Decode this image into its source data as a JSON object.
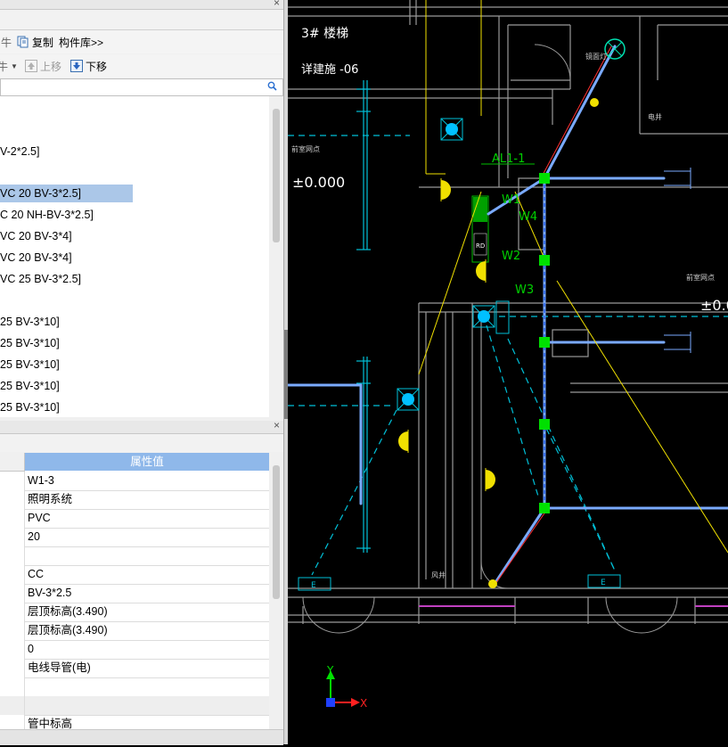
{
  "toolbar1": {
    "partial_label": "",
    "copy_label": "复制",
    "library_label": "构件库>>"
  },
  "toolbar2": {
    "up_label": "上移",
    "down_label": "下移"
  },
  "search": {
    "value": "",
    "placeholder": ""
  },
  "tree": {
    "items": [
      {
        "label": "V-2*2.5]"
      },
      {
        "label": "VC 20 BV-3*2.5]",
        "selected": true
      },
      {
        "label": "C 20 NH-BV-3*2.5]"
      },
      {
        "label": "VC 20 BV-3*4]"
      },
      {
        "label": "VC 20 BV-3*4]"
      },
      {
        "label": "VC 25 BV-3*2.5]"
      },
      {
        "label": "25 BV-3*10]"
      },
      {
        "label": "25 BV-3*10]"
      },
      {
        "label": "25 BV-3*10]"
      },
      {
        "label": "25 BV-3*10]"
      },
      {
        "label": "25 BV-3*10]"
      }
    ]
  },
  "properties": {
    "header": "属性值",
    "rows": [
      {
        "value": "W1-3"
      },
      {
        "value": "照明系统"
      },
      {
        "value": "PVC"
      },
      {
        "value": "20"
      },
      {
        "value": ""
      },
      {
        "value": "CC"
      },
      {
        "value": "BV-3*2.5"
      },
      {
        "value": "层顶标高(3.490)"
      },
      {
        "value": "层顶标高(3.490)"
      },
      {
        "value": "0"
      },
      {
        "value": "电线导管(电)"
      },
      {
        "value": ""
      },
      {
        "value": "",
        "group": true
      },
      {
        "value": "管中标高"
      }
    ]
  },
  "cad": {
    "labels": {
      "stair": "3# 楼梯",
      "detail": "详建施  -06",
      "elev_left": "±0.000",
      "elev_right": "±0.0",
      "al": "AL1-1",
      "w1": "W1",
      "w2": "W2",
      "w3": "W3",
      "w4": "W4",
      "rd": "RD",
      "e1": "E",
      "e2": "E",
      "room1": "电井",
      "room_left": "前室网点",
      "room_right": "前室网点",
      "top_small": "镜面灯",
      "shaft": "风井",
      "axis_x": "X",
      "axis_y": "Y"
    },
    "colors": {
      "background": "#000000",
      "wall": "#9a9a9a",
      "pipe_blue": "#7aaaff",
      "cyan": "#00c0d8",
      "green_node": "#00e000",
      "yellow": "#f0e000",
      "red": "#ff3030"
    }
  }
}
